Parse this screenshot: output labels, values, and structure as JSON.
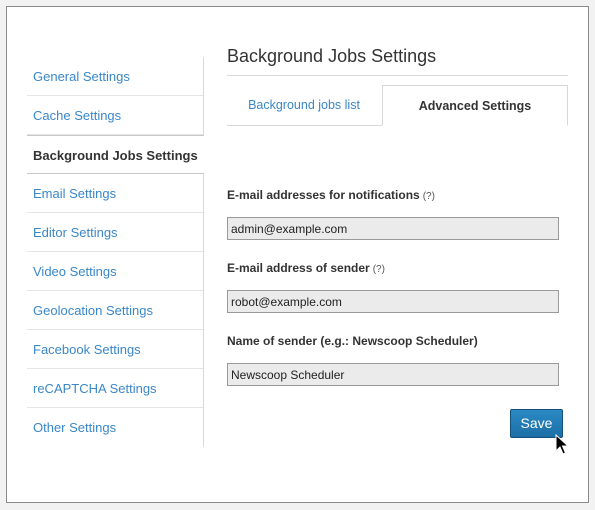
{
  "sidebar": {
    "items": [
      {
        "label": "General Settings",
        "active": false
      },
      {
        "label": "Cache Settings",
        "active": false
      },
      {
        "label": "Background Jobs Settings",
        "active": true
      },
      {
        "label": "Email Settings",
        "active": false
      },
      {
        "label": "Editor Settings",
        "active": false
      },
      {
        "label": "Video Settings",
        "active": false
      },
      {
        "label": "Geolocation Settings",
        "active": false
      },
      {
        "label": "Facebook Settings",
        "active": false
      },
      {
        "label": "reCAPTCHA Settings",
        "active": false
      },
      {
        "label": "Other Settings",
        "active": false
      }
    ]
  },
  "main": {
    "title": "Background Jobs Settings",
    "tabs": [
      {
        "label": "Background jobs list",
        "active": false
      },
      {
        "label": "Advanced Settings",
        "active": true
      }
    ]
  },
  "form": {
    "fields": [
      {
        "label": "E-mail addresses for notifications",
        "help": "(?)",
        "value": "admin@example.com"
      },
      {
        "label": "E-mail address of sender",
        "help": "(?)",
        "value": "robot@example.com"
      },
      {
        "label": "Name of sender (e.g.: Newscoop Scheduler)",
        "help": "",
        "value": "Newscoop Scheduler"
      }
    ],
    "save_label": "Save"
  },
  "colors": {
    "link": "#3a87c8",
    "primary_button": "#1d6fa6"
  }
}
